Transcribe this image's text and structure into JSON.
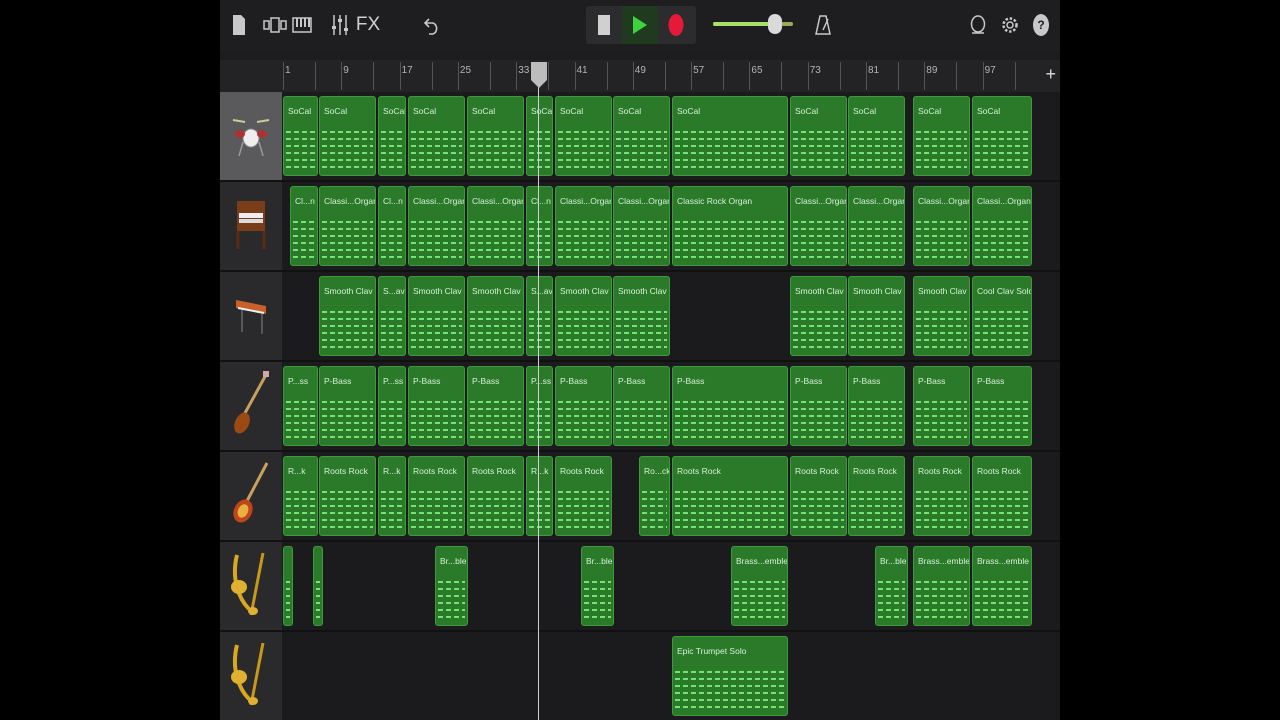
{
  "toolbar": {
    "icons": [
      "my-songs-icon",
      "browser-icon",
      "tracks-view-icon",
      "mixer-icon",
      "undo-icon",
      "stop-icon",
      "play-icon",
      "record-icon",
      "metronome-icon",
      "loop-icon",
      "settings-icon",
      "help-icon"
    ],
    "fx_label": "FX",
    "master_volume": 0.78,
    "colors": {
      "play": "#3fd23f",
      "record": "#e5193a",
      "region": "#2a7a2a",
      "notes": "#7cf07c"
    }
  },
  "ruler": {
    "bars": [
      "1",
      "9",
      "17",
      "25",
      "33",
      "41",
      "49",
      "57",
      "65",
      "73",
      "81",
      "89",
      "97"
    ],
    "add_label": "+"
  },
  "tracks": [
    {
      "name": "drums-track",
      "icon": "drum-kit-icon",
      "selected": true,
      "regions": [
        {
          "label": "SoCal"
        },
        {
          "label": "SoCal"
        },
        {
          "label": "SoCal"
        },
        {
          "label": "SoCal"
        },
        {
          "label": "SoCal"
        },
        {
          "label": "SoCal"
        },
        {
          "label": "SoCal"
        },
        {
          "label": "SoCal"
        },
        {
          "label": "SoCal"
        },
        {
          "label": "SoCal"
        },
        {
          "label": "SoCal"
        },
        {
          "label": "SoCal"
        },
        {
          "label": "SoCal"
        }
      ]
    },
    {
      "name": "organ-track",
      "icon": "organ-icon",
      "selected": false,
      "regions": [
        {
          "label": "Cl...n"
        },
        {
          "label": "Classi...Organ"
        },
        {
          "label": "Cl...n"
        },
        {
          "label": "Classi...Organ"
        },
        {
          "label": "Classi...Organ"
        },
        {
          "label": "Cl...n"
        },
        {
          "label": "Classi...Organ"
        },
        {
          "label": "Classi...Organ"
        },
        {
          "label": "Classic Rock Organ"
        },
        {
          "label": "Classi...Organ"
        },
        {
          "label": "Classi...Organ"
        },
        {
          "label": "Classi...Organ"
        },
        {
          "label": "Classi...Organ"
        }
      ]
    },
    {
      "name": "clav-track",
      "icon": "clavinet-icon",
      "selected": false,
      "regions": [
        {
          "label": "Smooth Clav"
        },
        {
          "label": "S...av"
        },
        {
          "label": "Smooth Clav"
        },
        {
          "label": "Smooth Clav"
        },
        {
          "label": "S...av"
        },
        {
          "label": "Smooth Clav"
        },
        {
          "label": "Smooth Clav"
        },
        {
          "label": "Smooth Clav"
        },
        {
          "label": "Smooth Clav"
        },
        {
          "label": "Smooth Clav"
        },
        {
          "label": "Cool Clav Solo"
        }
      ]
    },
    {
      "name": "bass-track",
      "icon": "bass-guitar-icon",
      "selected": false,
      "regions": [
        {
          "label": "P...ss"
        },
        {
          "label": "P-Bass"
        },
        {
          "label": "P...ss"
        },
        {
          "label": "P-Bass"
        },
        {
          "label": "P-Bass"
        },
        {
          "label": "P...ss"
        },
        {
          "label": "P-Bass"
        },
        {
          "label": "P-Bass"
        },
        {
          "label": "P-Bass"
        },
        {
          "label": "P-Bass"
        },
        {
          "label": "P-Bass"
        },
        {
          "label": "P-Bass"
        },
        {
          "label": "P-Bass"
        }
      ]
    },
    {
      "name": "guitar-track",
      "icon": "electric-guitar-icon",
      "selected": false,
      "regions": [
        {
          "label": "R...k"
        },
        {
          "label": "Roots Rock"
        },
        {
          "label": "R...k"
        },
        {
          "label": "Roots Rock"
        },
        {
          "label": "Roots Rock"
        },
        {
          "label": "R...k"
        },
        {
          "label": "Roots Rock"
        },
        {
          "label": "Ro...ck"
        },
        {
          "label": "Roots Rock"
        },
        {
          "label": "Roots Rock"
        },
        {
          "label": "Roots Rock"
        },
        {
          "label": "Roots Rock"
        },
        {
          "label": "Roots Rock"
        }
      ]
    },
    {
      "name": "brass-track",
      "icon": "brass-icon",
      "selected": false,
      "regions": [
        {
          "label": ""
        },
        {
          "label": ""
        },
        {
          "label": "Br...ble"
        },
        {
          "label": "Br...ble"
        },
        {
          "label": "Brass...emble"
        },
        {
          "label": "Br...ble"
        },
        {
          "label": "Brass...emble"
        },
        {
          "label": "Brass...emble"
        }
      ]
    },
    {
      "name": "trumpet-track",
      "icon": "trumpet-icon",
      "selected": false,
      "regions": [
        {
          "label": "Epic Trumpet Solo"
        }
      ]
    }
  ]
}
